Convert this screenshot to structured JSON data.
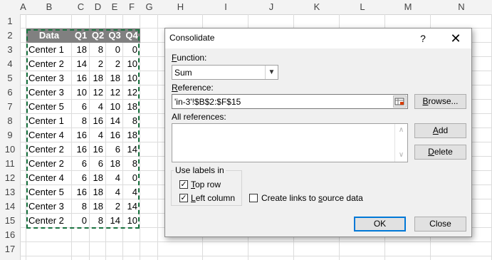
{
  "columns": [
    "A",
    "B",
    "C",
    "D",
    "E",
    "F",
    "G",
    "H",
    "I",
    "J",
    "K",
    "L",
    "M",
    "N"
  ],
  "rows": [
    "1",
    "2",
    "3",
    "4",
    "5",
    "6",
    "7",
    "8",
    "9",
    "10",
    "11",
    "12",
    "13",
    "14",
    "15",
    "16",
    "17"
  ],
  "table": {
    "headers": [
      "Data",
      "Q1",
      "Q2",
      "Q3",
      "Q4"
    ],
    "rows": [
      [
        "Center 1",
        "18",
        "8",
        "0",
        "0"
      ],
      [
        "Center 2",
        "14",
        "2",
        "2",
        "10"
      ],
      [
        "Center 3",
        "16",
        "18",
        "18",
        "10"
      ],
      [
        "Center 3",
        "10",
        "12",
        "12",
        "12"
      ],
      [
        "Center 5",
        "6",
        "4",
        "10",
        "18"
      ],
      [
        "Center 1",
        "8",
        "16",
        "14",
        "8"
      ],
      [
        "Center 4",
        "16",
        "4",
        "16",
        "18"
      ],
      [
        "Center 2",
        "16",
        "16",
        "6",
        "14"
      ],
      [
        "Center 2",
        "6",
        "6",
        "18",
        "8"
      ],
      [
        "Center 4",
        "6",
        "18",
        "4",
        "0"
      ],
      [
        "Center 5",
        "16",
        "18",
        "4",
        "4"
      ],
      [
        "Center 3",
        "8",
        "18",
        "2",
        "14"
      ],
      [
        "Center 2",
        "0",
        "8",
        "14",
        "10"
      ]
    ]
  },
  "dialog": {
    "title": "Consolidate",
    "help": "?",
    "close": "✕",
    "function_label": "Function:",
    "function_value": "Sum",
    "reference_label": "Reference:",
    "reference_value": "'in-3'!$B$2:$F$15",
    "all_references_label": "All references:",
    "browse_label": "Browse...",
    "add_label": "Add",
    "delete_label": "Delete",
    "use_labels_title": "Use labels in",
    "top_row_label": "Top row",
    "top_row_checked": true,
    "left_column_label": "Left column",
    "left_column_checked": true,
    "create_links_label": "Create links to source data",
    "create_links_checked": false,
    "ok_label": "OK",
    "close_label": "Close"
  },
  "colors": {
    "marquee": "#1a7340",
    "header_fill": "#808080",
    "default_button_border": "#0078d7"
  }
}
